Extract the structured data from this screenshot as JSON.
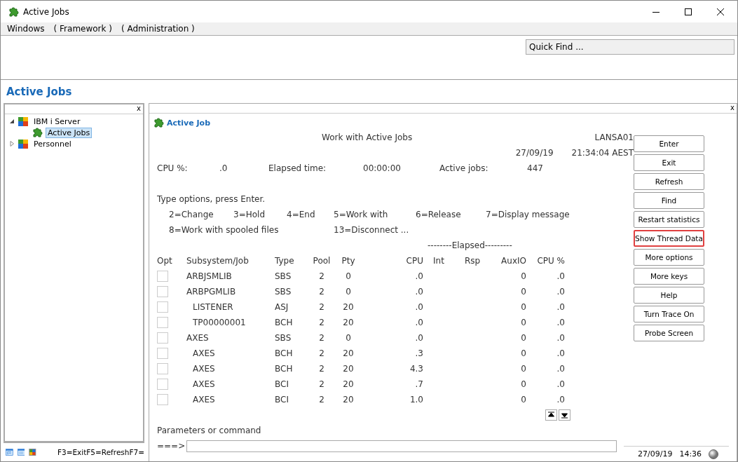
{
  "window": {
    "title": "Active Jobs"
  },
  "menu": [
    {
      "label": "Windows"
    },
    {
      "label": "( Framework )"
    },
    {
      "label": "( Administration )"
    }
  ],
  "quick_find": {
    "placeholder": "Quick Find ..."
  },
  "heading": "Active Jobs",
  "tree": [
    {
      "label": "IBM i Server",
      "expanded": true,
      "selected": false,
      "children": [
        {
          "label": "Active Jobs",
          "selected": true
        }
      ]
    },
    {
      "label": "Personnel",
      "expanded": false,
      "selected": false
    }
  ],
  "tree_panel": {
    "close": "x"
  },
  "panel": {
    "title": "Active Job",
    "close": "x"
  },
  "screen": {
    "title": "Work with Active Jobs",
    "system": "LANSA01",
    "date": "27/09/19",
    "time": "21:34:04 AEST",
    "stats": [
      {
        "label": "CPU %:",
        "value": ".0"
      },
      {
        "label": "Elapsed time:",
        "value": "00:00:00"
      },
      {
        "label": "Active jobs:",
        "value": "447"
      }
    ],
    "instruction": "Type options, press Enter.",
    "options": [
      [
        "2=Change",
        "3=Hold",
        "4=End",
        "5=Work with",
        "6=Release",
        "7=Display message"
      ],
      [
        "8=Work with spooled files",
        "13=Disconnect ..."
      ]
    ],
    "group_header": "--------Elapsed---------",
    "columns": [
      "Opt",
      "Subsystem/Job",
      "Type",
      "Pool",
      "Pty",
      "CPU",
      "Int",
      "Rsp",
      "AuxIO",
      "CPU %"
    ],
    "rows": [
      {
        "job": "ARBJSMLIB",
        "type": "SBS",
        "pool": "2",
        "pty": "0",
        "cpu": ".0",
        "auxio": "0",
        "cpu_pct": ".0"
      },
      {
        "job": "ARBPGMLIB",
        "type": "SBS",
        "pool": "2",
        "pty": "0",
        "cpu": ".0",
        "auxio": "0",
        "cpu_pct": ".0",
        "children": [
          {
            "job": "LISTENER",
            "type": "ASJ",
            "pool": "2",
            "pty": "20",
            "cpu": ".0",
            "auxio": "0",
            "cpu_pct": ".0"
          },
          {
            "job": "TP00000001",
            "type": "BCH",
            "pool": "2",
            "pty": "20",
            "cpu": ".0",
            "auxio": "0",
            "cpu_pct": ".0"
          }
        ]
      },
      {
        "job": "AXES",
        "type": "SBS",
        "pool": "2",
        "pty": "0",
        "cpu": ".0",
        "auxio": "0",
        "cpu_pct": ".0",
        "children": [
          {
            "job": "AXES",
            "type": "BCH",
            "pool": "2",
            "pty": "20",
            "cpu": ".3",
            "auxio": "0",
            "cpu_pct": ".0"
          },
          {
            "job": "AXES",
            "type": "BCH",
            "pool": "2",
            "pty": "20",
            "cpu": "4.3",
            "auxio": "0",
            "cpu_pct": ".0"
          },
          {
            "job": "AXES",
            "type": "BCI",
            "pool": "2",
            "pty": "20",
            "cpu": ".7",
            "auxio": "0",
            "cpu_pct": ".0"
          },
          {
            "job": "AXES",
            "type": "BCI",
            "pool": "2",
            "pty": "20",
            "cpu": "1.0",
            "auxio": "0",
            "cpu_pct": ".0"
          }
        ]
      }
    ],
    "command": {
      "label": "Parameters or command",
      "prompt": "===>"
    }
  },
  "buttons": [
    {
      "label": "Enter",
      "highlighted": false
    },
    {
      "label": "Exit",
      "highlighted": false
    },
    {
      "label": "Refresh",
      "highlighted": false
    },
    {
      "label": "Find",
      "highlighted": false
    },
    {
      "label": "Restart statistics",
      "highlighted": false
    },
    {
      "label": "Show Thread Data",
      "highlighted": true
    },
    {
      "label": "More options",
      "highlighted": false
    },
    {
      "label": "More keys",
      "highlighted": false
    },
    {
      "label": "Help",
      "highlighted": false
    },
    {
      "label": "Turn Trace On",
      "highlighted": false
    },
    {
      "label": "Probe Screen",
      "highlighted": false
    }
  ],
  "status_bar": {
    "function_keys": "F3=ExitF5=RefreshF7=",
    "date": "27/09/19",
    "time": "14:36"
  }
}
